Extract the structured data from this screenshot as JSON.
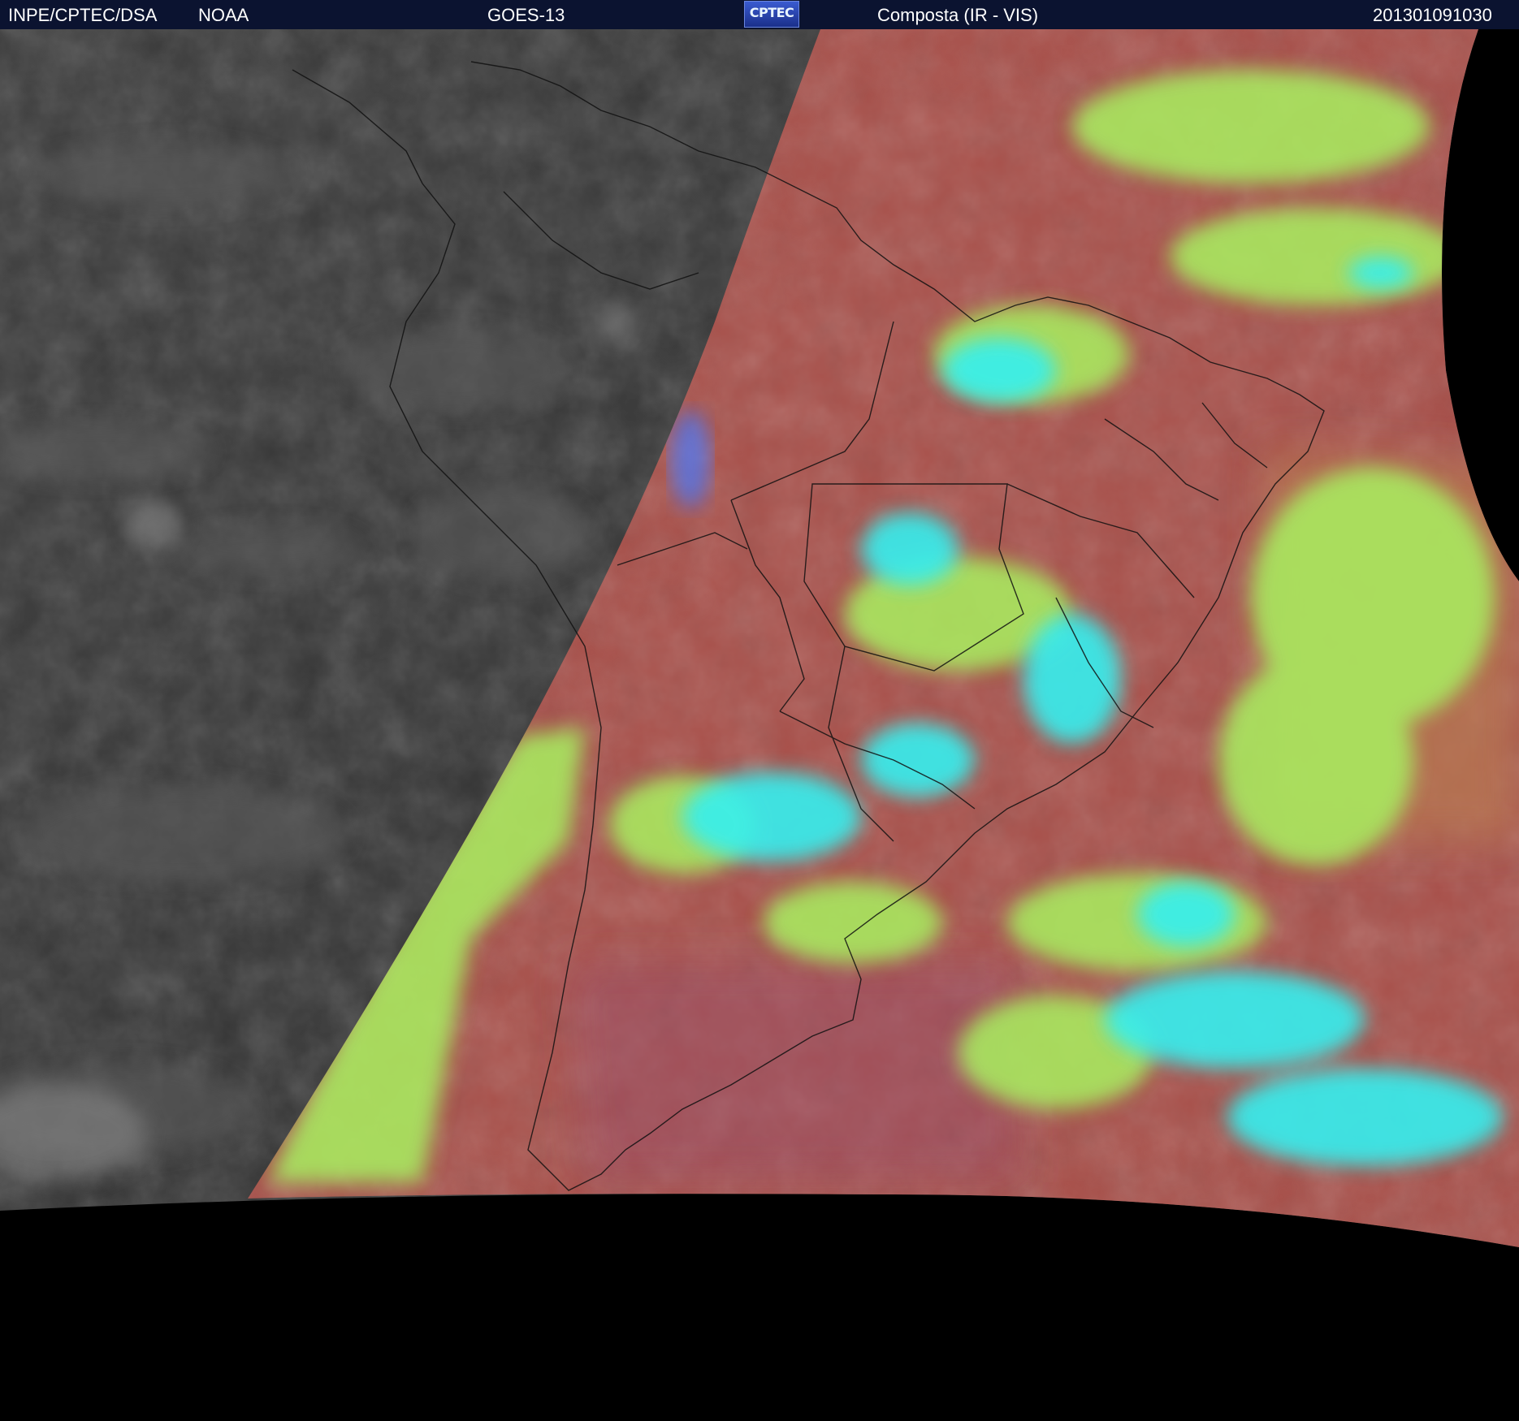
{
  "header": {
    "source": "INPE/CPTEC/DSA",
    "agency": "NOAA",
    "satellite": "GOES-13",
    "logo_text": "CPTEC",
    "product": "Composta (IR - VIS)",
    "timestamp": "201301091030"
  },
  "colors": {
    "header_bg": "#0b1330",
    "night_side": "#3a3a3a",
    "land_composite": "#a8504a",
    "clouds_high": "#35f0f0",
    "clouds_low": "#a8f060",
    "space": "#000000"
  }
}
